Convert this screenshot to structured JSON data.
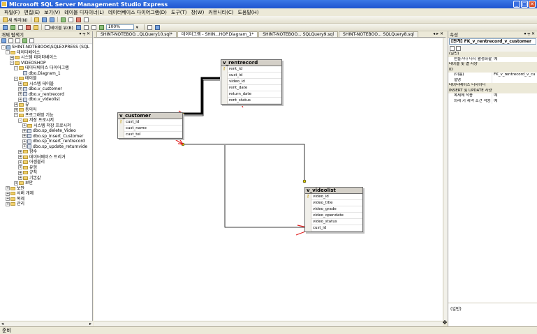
{
  "window": {
    "title": "Microsoft SQL Server Management Studio Express"
  },
  "menu": [
    "파일(F)",
    "편집(E)",
    "보기(V)",
    "테이블 디자이너(L)",
    "데이터베이스 다이어그램(D)",
    "도구(T)",
    "창(W)",
    "커뮤니티(C)",
    "도움말(H)"
  ],
  "toolbar": {
    "new_query_label": "새 쿼리(N)",
    "table_view_label": "테이블 뷰(B)",
    "zoom_value": "100%"
  },
  "object_explorer": {
    "title": "개체 탐색기",
    "nodes": [
      {
        "label": "SHINT-NOTEBOOK\\SQLEXPRESS (SQL",
        "exp": "-"
      },
      {
        "label": "데이터베이스",
        "exp": "-"
      },
      {
        "label": "시스템 데이터베이스",
        "exp": "+"
      },
      {
        "label": "VIDEOSHOP",
        "exp": "-"
      },
      {
        "label": "데이터베이스 다이어그램",
        "exp": "-"
      },
      {
        "label": "dbo.Diagram_1",
        "exp": ""
      },
      {
        "label": "테이블",
        "exp": "-"
      },
      {
        "label": "시스템 테이블",
        "exp": "+"
      },
      {
        "label": "dbo.v_customer",
        "exp": "+"
      },
      {
        "label": "dbo.v_rentrecord",
        "exp": "+"
      },
      {
        "label": "dbo.v_videolist",
        "exp": "+"
      },
      {
        "label": "뷰",
        "exp": "+"
      },
      {
        "label": "동의어",
        "exp": "+"
      },
      {
        "label": "프로그래밍 기능",
        "exp": "-"
      },
      {
        "label": "저장 프로시저",
        "exp": "-"
      },
      {
        "label": "시스템 저장 프로시저",
        "exp": "+"
      },
      {
        "label": "dbo.sp_delete_Video",
        "exp": "+"
      },
      {
        "label": "dbo.sp_Insert_Customer",
        "exp": "+"
      },
      {
        "label": "dbo.sp_Insert_rentrecord",
        "exp": "+"
      },
      {
        "label": "dbo.sp_update_returnvide",
        "exp": "+"
      },
      {
        "label": "함수",
        "exp": "+"
      },
      {
        "label": "데이터베이스 트리거",
        "exp": "+"
      },
      {
        "label": "어셈블리",
        "exp": "+"
      },
      {
        "label": "유형",
        "exp": "+"
      },
      {
        "label": "규칙",
        "exp": "+"
      },
      {
        "label": "기본값",
        "exp": "+"
      },
      {
        "label": "보안",
        "exp": "+"
      },
      {
        "label": "보안",
        "exp": "+"
      },
      {
        "label": "서버 개체",
        "exp": "+"
      },
      {
        "label": "복제",
        "exp": "+"
      },
      {
        "label": "관리",
        "exp": "+"
      }
    ]
  },
  "tabs": [
    {
      "label": "SHINT-NOTEBOO...QLQuery10.sql*",
      "active": false
    },
    {
      "label": "데이터그램 - SHIN...HOP.Diagram_1*",
      "active": true
    },
    {
      "label": "SHINT-NOTEBOO... SQLQuery9.sql",
      "active": false
    },
    {
      "label": "SHINT-NOTEBOO... SQLQuery8.sql",
      "active": false
    }
  ],
  "diagram": {
    "tables": {
      "rentrecord": {
        "name": "v_rentrecord",
        "columns": [
          "rent_id",
          "cust_id",
          "video_id",
          "rent_date",
          "return_date",
          "rent_status"
        ],
        "keys": [
          0
        ]
      },
      "customer": {
        "name": "v_customer",
        "columns": [
          "cust_id",
          "cust_name",
          "cust_tel"
        ],
        "keys": [
          0
        ]
      },
      "videolist": {
        "name": "v_videolist",
        "columns": [
          "video_id",
          "video_title",
          "video_grade",
          "video_opendate",
          "video_status",
          "cust_id"
        ],
        "keys": [
          0
        ]
      }
    },
    "key_icon": "key-icon"
  },
  "properties": {
    "title": "속성",
    "object": "[관계] FK_v_rentrecord_v_customer",
    "rows": [
      {
        "k": "(일반)",
        "v": "",
        "cat": true
      },
      {
        "k": "만들거나 다시 활성화할 때",
        "v": "예"
      },
      {
        "k": "테이블 및 열 사양",
        "v": "",
        "cat": true
      },
      {
        "k": "ID",
        "v": "",
        "cat": true
      },
      {
        "k": "(이름)",
        "v": "FK_v_rentrecord_v_cu"
      },
      {
        "k": "설명",
        "v": ""
      },
      {
        "k": "데이터베이스 디자이너",
        "v": "",
        "cat": true
      },
      {
        "k": "INSERT 및 UPDATE 사양",
        "v": "",
        "cat": true
      },
      {
        "k": "복제에 적용",
        "v": "예"
      },
      {
        "k": "외래 키 제약 조건 적용",
        "v": "예"
      }
    ],
    "description": "(일반)"
  },
  "status": {
    "text": "준비"
  },
  "colors": {
    "title_bar": "#2a63dc",
    "chrome": "#ece9d8",
    "arrow": "#e02020",
    "relation_line": "#000000"
  }
}
